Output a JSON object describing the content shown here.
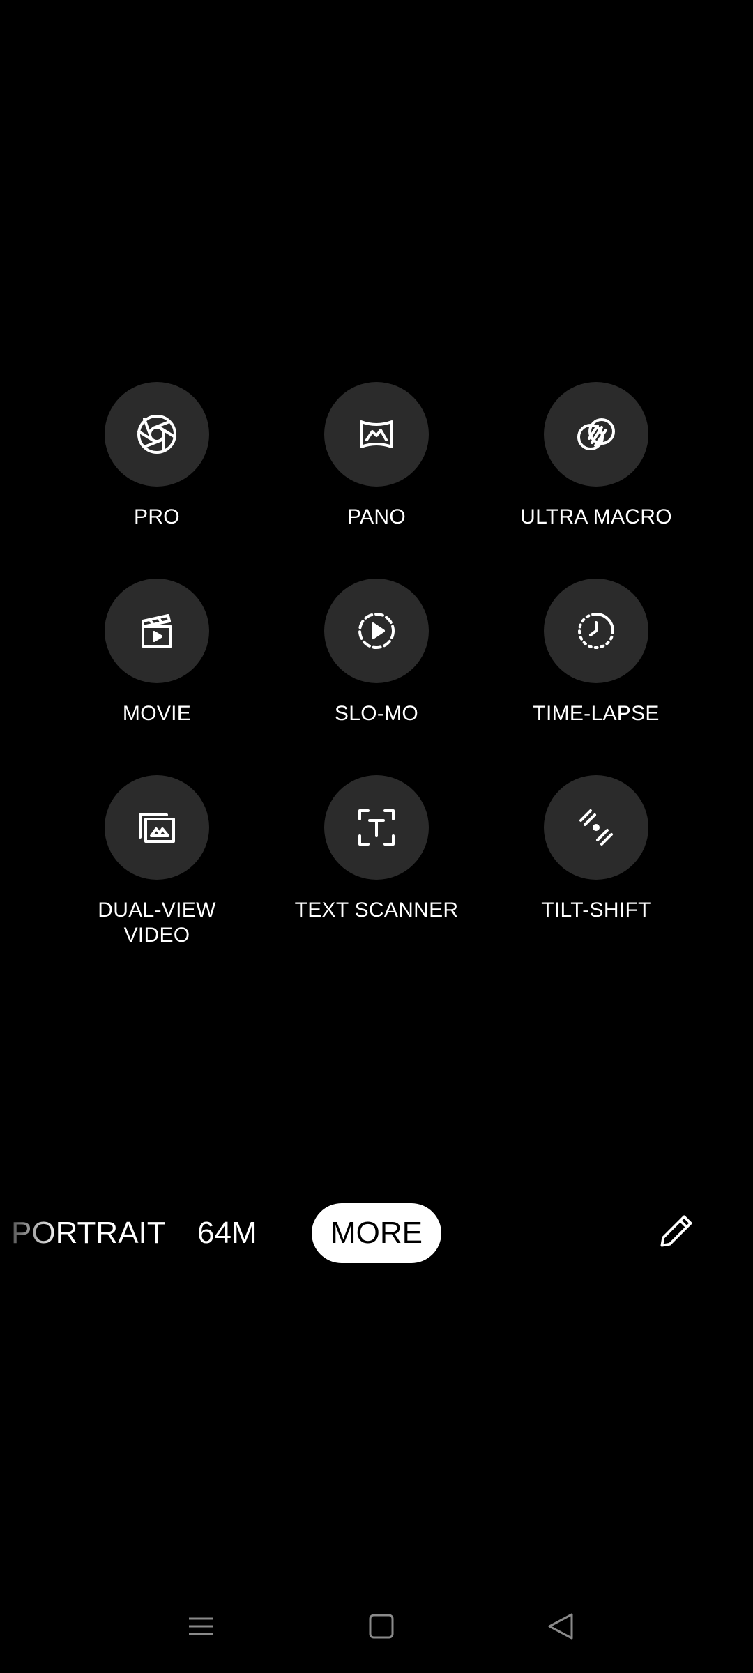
{
  "modes": [
    {
      "label": "PRO",
      "icon": "aperture-icon"
    },
    {
      "label": "PANO",
      "icon": "panorama-icon"
    },
    {
      "label": "ULTRA MACRO",
      "icon": "macro-icon"
    },
    {
      "label": "MOVIE",
      "icon": "clapperboard-icon"
    },
    {
      "label": "SLO-MO",
      "icon": "slow-motion-icon"
    },
    {
      "label": "TIME-LAPSE",
      "icon": "time-lapse-icon"
    },
    {
      "label": "DUAL-VIEW VIDEO",
      "icon": "dual-view-icon"
    },
    {
      "label": "TEXT SCANNER",
      "icon": "text-scanner-icon"
    },
    {
      "label": "TILT-SHIFT",
      "icon": "tilt-shift-icon"
    }
  ],
  "mode_bar": {
    "portrait": "PORTRAIT",
    "resolution": "64M",
    "more": "MORE",
    "edit_icon": "pencil-icon"
  },
  "nav_bar": {
    "recents_icon": "menu-icon",
    "home_icon": "home-square-icon",
    "back_icon": "back-triangle-icon"
  },
  "colors": {
    "background": "#000000",
    "circle": "#2b2b2b",
    "text": "#ffffff",
    "selected_pill": "#ffffff",
    "nav_icon": "#8a8a8a"
  }
}
